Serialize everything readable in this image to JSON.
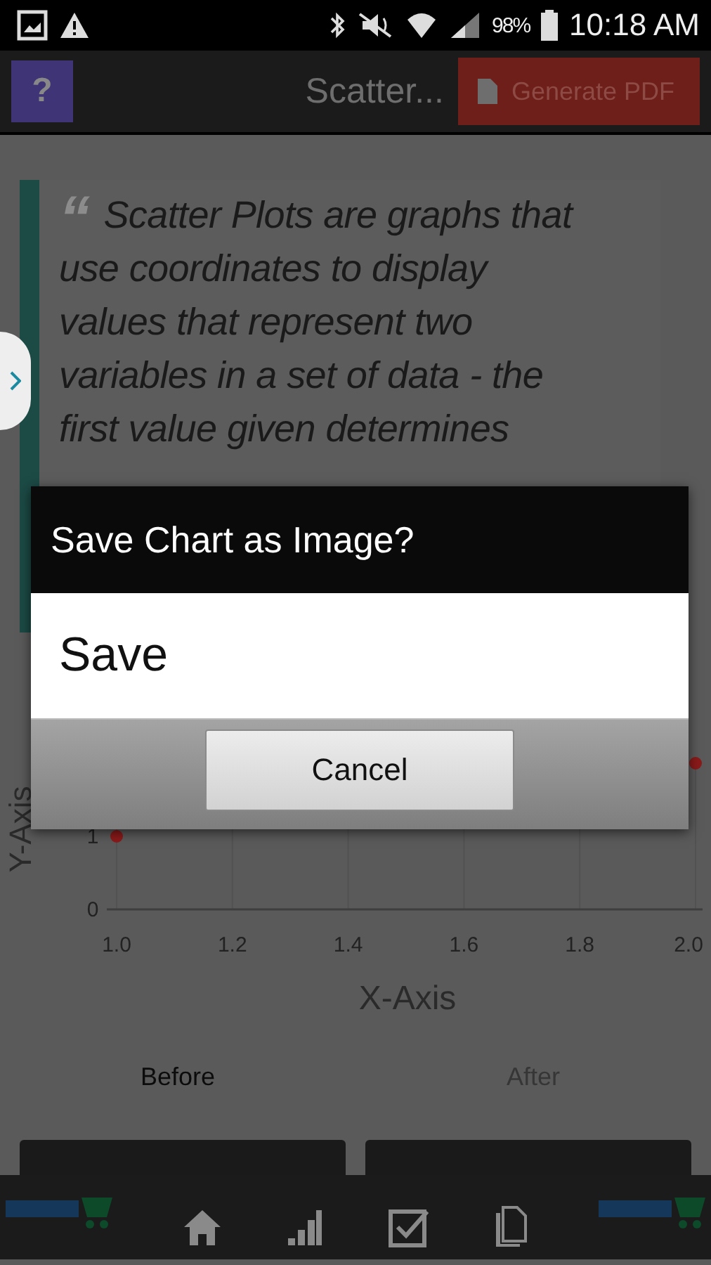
{
  "status_bar": {
    "battery": "98%",
    "time": "10:18 AM"
  },
  "app_bar": {
    "help_button": "?",
    "title": "Scatter...",
    "pdf_button": "Generate PDF"
  },
  "quote": {
    "mark": "“",
    "lines": [
      "Scatter Plots are graphs that",
      "use coordinates to display",
      "values that represent two",
      "variables in a set of data - the",
      "first value given determines"
    ]
  },
  "chart": {
    "chart_data": {
      "type": "scatter",
      "xlabel": "X-Axis",
      "ylabel": "Y-Axis",
      "x": [
        1.0,
        2.0
      ],
      "series": [
        {
          "color": "#8b1a1a",
          "values": [
            1,
            2
          ]
        }
      ],
      "xlim": [
        1,
        2
      ],
      "ylim": [
        0,
        2
      ],
      "grid": true,
      "xticks": [
        {
          "value": 1,
          "label": "1.0"
        },
        {
          "value": 1.2,
          "label": "1.2"
        },
        {
          "value": 1.4,
          "label": "1.4"
        },
        {
          "value": 1.6,
          "label": "1.6"
        },
        {
          "value": 1.8,
          "label": "1.8"
        },
        {
          "value": 2,
          "label": "2.0"
        }
      ],
      "yticks": [
        0,
        1
      ]
    }
  },
  "tabs": [
    {
      "label": "Before",
      "selected": true
    },
    {
      "label": "After",
      "selected": false
    }
  ],
  "dialog": {
    "title": "Save Chart as Image?",
    "options": [
      "Save"
    ],
    "cancel": "Cancel"
  },
  "bottom_nav": [
    {
      "kind": "logo"
    },
    {
      "kind": "home"
    },
    {
      "kind": "chart"
    },
    {
      "kind": "check"
    },
    {
      "kind": "document"
    },
    {
      "kind": "logo"
    }
  ]
}
